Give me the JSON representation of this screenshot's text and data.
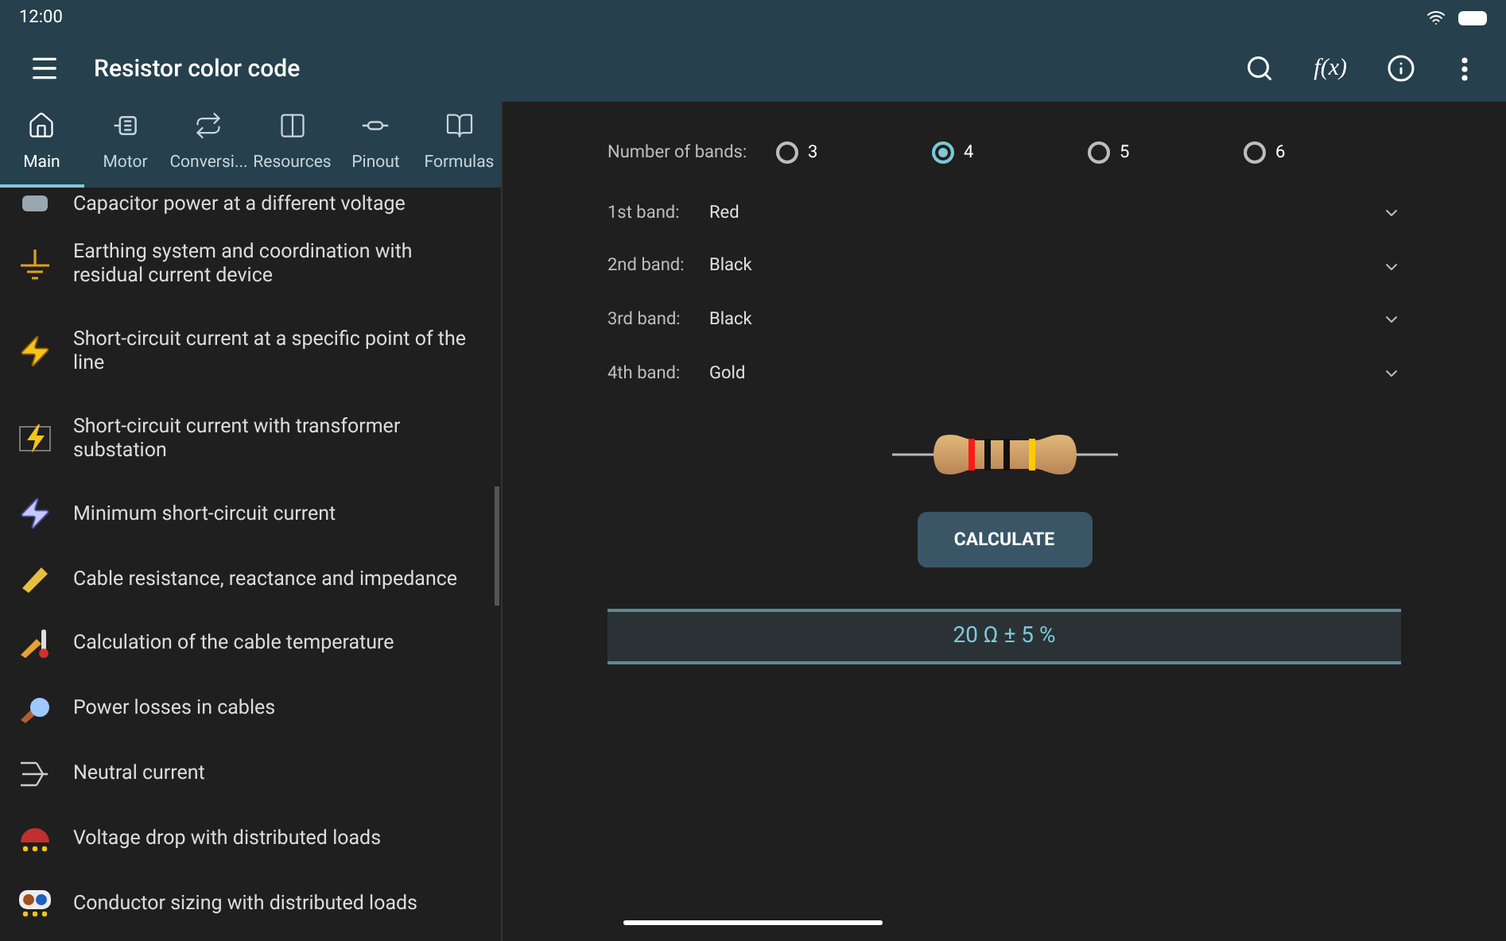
{
  "status_bar": {
    "time": "12:00"
  },
  "app_bar": {
    "title": "Resistor color code",
    "function_label": "f(x)"
  },
  "tabs": [
    {
      "label": "Main",
      "selected": true
    },
    {
      "label": "Motor",
      "selected": false
    },
    {
      "label": "Conversi...",
      "selected": false
    },
    {
      "label": "Resources",
      "selected": false
    },
    {
      "label": "Pinout",
      "selected": false
    },
    {
      "label": "Formulas",
      "selected": false
    }
  ],
  "sidebar": {
    "items": [
      {
        "label": "Capacitor power at a different voltage"
      },
      {
        "label": "Earthing system and coordination with residual current device"
      },
      {
        "label": "Short-circuit current at a specific point of the line"
      },
      {
        "label": "Short-circuit current with transformer substation"
      },
      {
        "label": "Minimum short-circuit current"
      },
      {
        "label": "Cable resistance, reactance and impedance"
      },
      {
        "label": "Calculation of the cable temperature"
      },
      {
        "label": "Power losses in cables"
      },
      {
        "label": "Neutral current"
      },
      {
        "label": "Voltage drop with distributed loads"
      },
      {
        "label": "Conductor sizing with distributed loads"
      }
    ]
  },
  "band_count": {
    "label": "Number of bands:",
    "options": [
      {
        "label": "3",
        "selected": false
      },
      {
        "label": "4",
        "selected": true
      },
      {
        "label": "5",
        "selected": false
      },
      {
        "label": "6",
        "selected": false
      }
    ]
  },
  "bands": [
    {
      "label": "1st band:",
      "value": "Red",
      "color": "#ff1a1a"
    },
    {
      "label": "2nd band:",
      "value": "Black",
      "color": "#111111"
    },
    {
      "label": "3rd band:",
      "value": "Black",
      "color": "#111111"
    },
    {
      "label": "4th band:",
      "value": "Gold",
      "color": "#ffcc00"
    }
  ],
  "calculate_button": "CALCULATE",
  "result": "20 Ω ± 5 %"
}
